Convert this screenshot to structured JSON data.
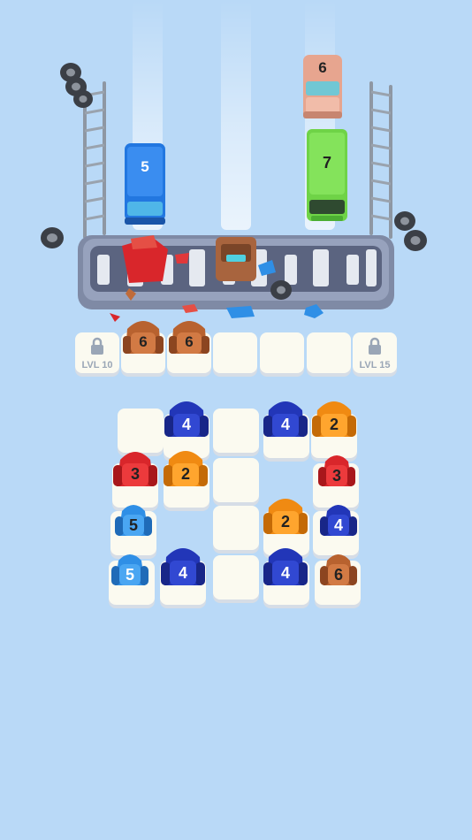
{
  "colors": {
    "background": "#b9d9f7",
    "red": "#d9262b",
    "orange": "#f08a12",
    "blue": "#2236b8",
    "lightblue": "#2f8fe6",
    "brown": "#b8622f",
    "green": "#6fd347"
  },
  "road": {
    "vehicles": [
      {
        "name": "pink-car",
        "number": "6",
        "color": "pink"
      },
      {
        "name": "green-bus",
        "number": "7",
        "color": "green"
      },
      {
        "name": "blue-truck",
        "number": "5",
        "color": "blue"
      }
    ]
  },
  "holding_slots": [
    {
      "locked": true,
      "label": "LVL 10"
    },
    {
      "locked": false,
      "vehicle": {
        "number": "6",
        "color": "brown"
      }
    },
    {
      "locked": false,
      "vehicle": {
        "number": "6",
        "color": "brown"
      }
    },
    {
      "locked": false
    },
    {
      "locked": false
    },
    {
      "locked": false
    },
    {
      "locked": true,
      "label": "LVL 15"
    }
  ],
  "grid": {
    "cars": [
      {
        "number": "4",
        "color": "blue"
      },
      {
        "number": "4",
        "color": "blue"
      },
      {
        "number": "2",
        "color": "orange"
      },
      {
        "number": "3",
        "color": "red"
      },
      {
        "number": "2",
        "color": "orange"
      },
      {
        "number": "3",
        "color": "red"
      },
      {
        "number": "5",
        "color": "lightblue"
      },
      {
        "number": "2",
        "color": "orange"
      },
      {
        "number": "4",
        "color": "blue"
      },
      {
        "number": "5",
        "color": "lightblue"
      },
      {
        "number": "4",
        "color": "blue"
      },
      {
        "number": "4",
        "color": "blue"
      },
      {
        "number": "6",
        "color": "brown"
      }
    ]
  }
}
